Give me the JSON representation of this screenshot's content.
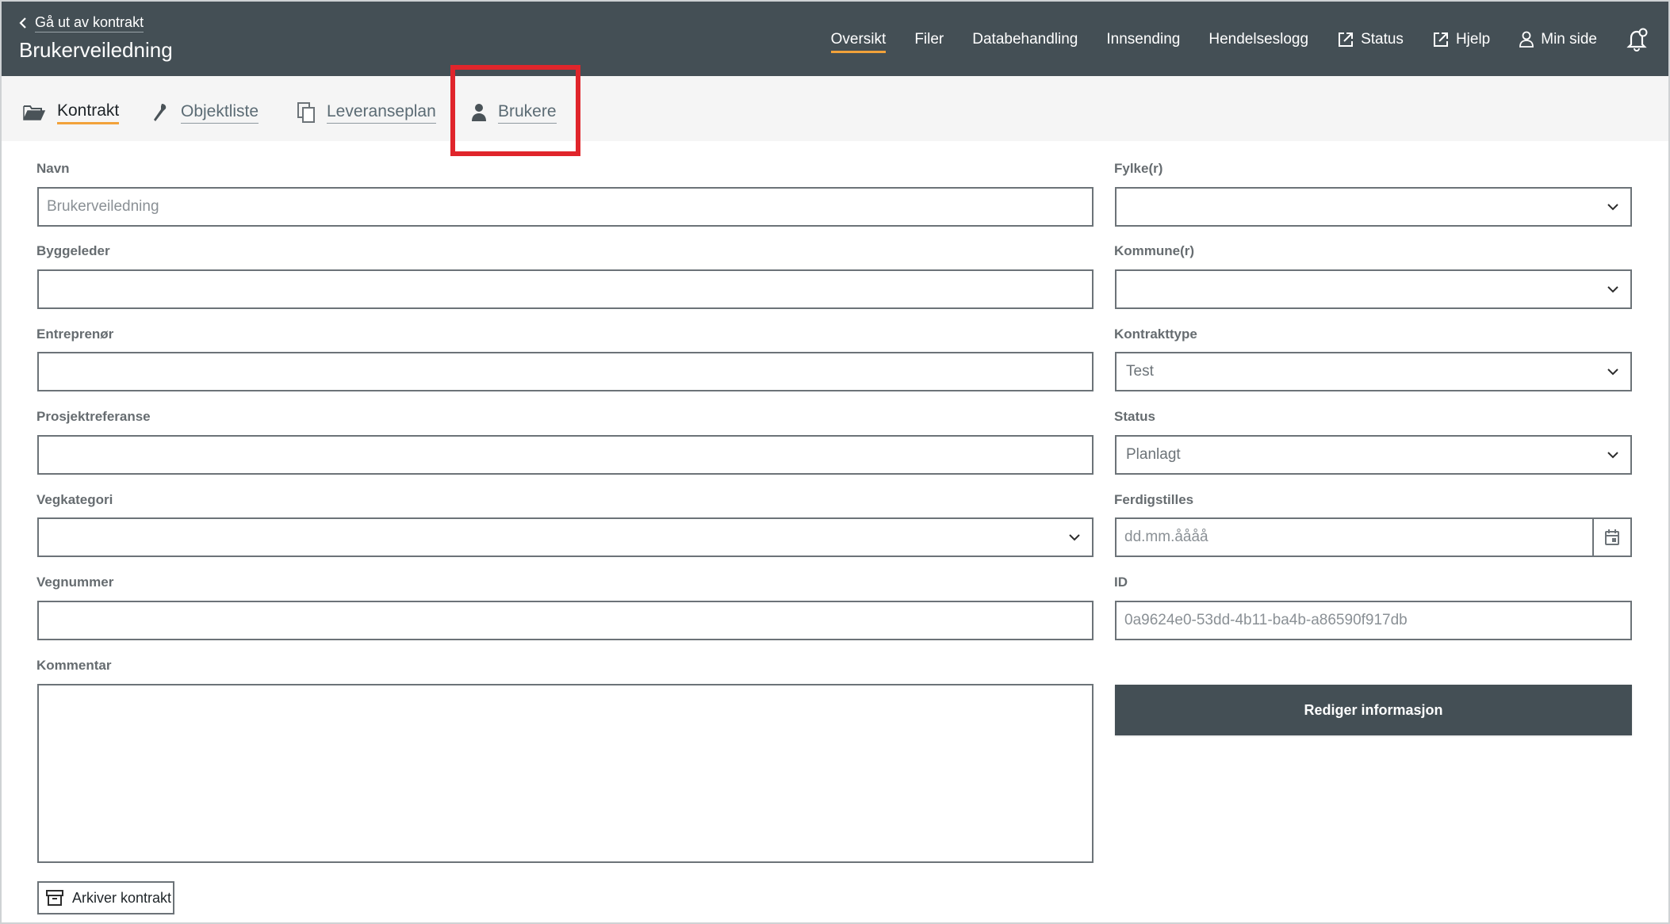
{
  "header": {
    "back_label": "Gå ut av kontrakt",
    "title": "Brukerveiledning",
    "nav": [
      {
        "label": "Oversikt",
        "icon": "",
        "active": true
      },
      {
        "label": "Filer",
        "icon": ""
      },
      {
        "label": "Databehandling",
        "icon": ""
      },
      {
        "label": "Innsending",
        "icon": ""
      },
      {
        "label": "Hendelseslogg",
        "icon": ""
      },
      {
        "label": "Status",
        "icon": "external-link-icon"
      },
      {
        "label": "Hjelp",
        "icon": "external-link-icon"
      },
      {
        "label": "Min side",
        "icon": "user-icon"
      }
    ],
    "notification_icon": "bell-icon"
  },
  "tabs": [
    {
      "label": "Kontrakt",
      "icon": "folder-open-icon",
      "active": true
    },
    {
      "label": "Objektliste",
      "icon": "wrench-icon"
    },
    {
      "label": "Leveranseplan",
      "icon": "copy-icon"
    },
    {
      "label": "Brukere",
      "icon": "person-icon",
      "highlighted": true
    }
  ],
  "form": {
    "navn": {
      "label": "Navn",
      "placeholder": "Brukerveiledning"
    },
    "byggeleder": {
      "label": "Byggeleder",
      "value": ""
    },
    "entreprenor": {
      "label": "Entreprenør",
      "value": ""
    },
    "prosjektreferanse": {
      "label": "Prosjektreferanse",
      "value": ""
    },
    "vegkategori": {
      "label": "Vegkategori",
      "value": ""
    },
    "vegnummer": {
      "label": "Vegnummer",
      "value": ""
    },
    "kommentar": {
      "label": "Kommentar",
      "value": ""
    },
    "fylker": {
      "label": "Fylke(r)",
      "value": ""
    },
    "kommuner": {
      "label": "Kommune(r)",
      "value": ""
    },
    "kontrakttype": {
      "label": "Kontrakttype",
      "value": "Test"
    },
    "status": {
      "label": "Status",
      "value": "Planlagt"
    },
    "ferdigstilles": {
      "label": "Ferdigstilles",
      "placeholder": "dd.mm.åååå"
    },
    "id": {
      "label": "ID",
      "value": "0a9624e0-53dd-4b11-ba4b-a86590f917db"
    }
  },
  "buttons": {
    "edit": "Rediger informasjon",
    "archive": "Arkiver kontrakt"
  },
  "colors": {
    "header_bg": "#444f55",
    "accent": "#f2a23a",
    "highlight": "#e0252b",
    "tabbar_bg": "#f5f5f5"
  }
}
